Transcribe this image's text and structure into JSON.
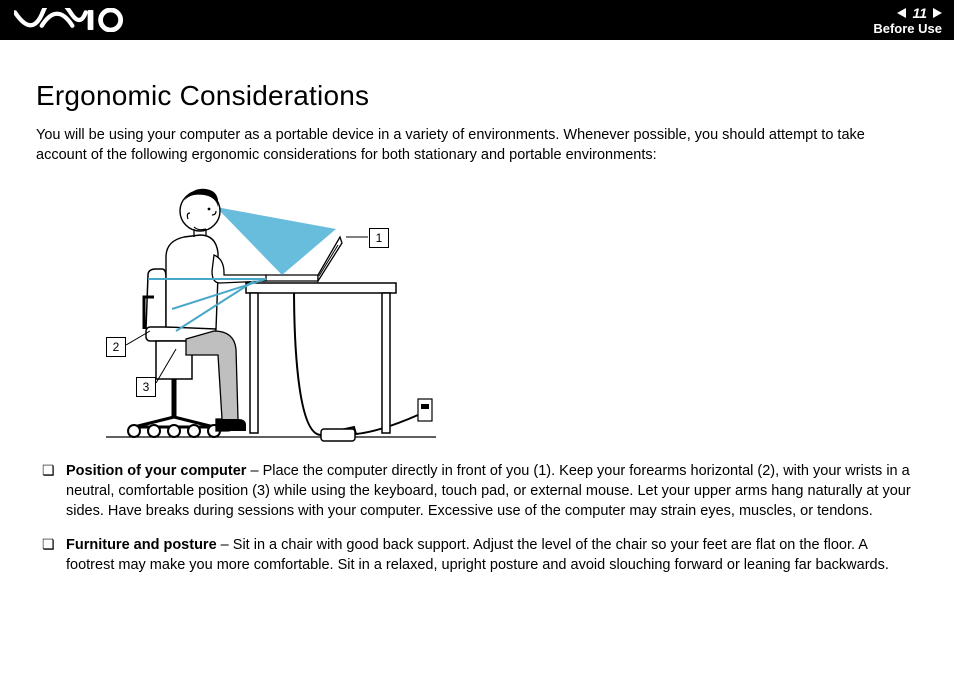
{
  "header": {
    "page_number": "11",
    "section": "Before Use"
  },
  "title": "Ergonomic Considerations",
  "intro": "You will be using your computer as a portable device in a variety of environments. Whenever possible, you should attempt to take account of the following ergonomic considerations for both stationary and portable environments:",
  "callouts": {
    "c1": "1",
    "c2": "2",
    "c3": "3"
  },
  "bullets": [
    {
      "term": "Position of your computer",
      "text": " – Place the computer directly in front of you (1). Keep your forearms horizontal (2), with your wrists in a neutral, comfortable position (3) while using the keyboard, touch pad, or external mouse. Let your upper arms hang naturally at your sides. Have breaks during sessions with your computer. Excessive use of the computer may strain eyes, muscles, or tendons."
    },
    {
      "term": "Furniture and posture",
      "text": " – Sit in a chair with good back support. Adjust the level of the chair so your feet are flat on the floor. A footrest may make you more comfortable. Sit in a relaxed, upright posture and avoid slouching forward or leaning far backwards."
    }
  ]
}
